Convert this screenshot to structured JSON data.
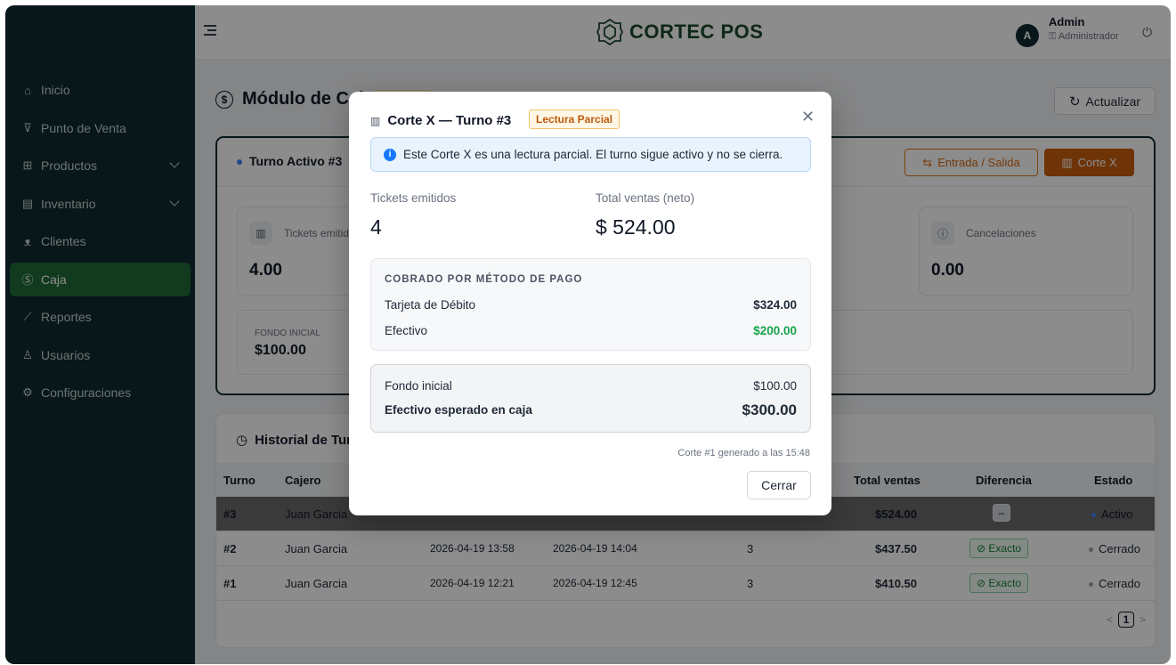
{
  "brand": {
    "name": "CORTEC POS"
  },
  "user": {
    "initial": "A",
    "name": "Admin",
    "role": "Administrador"
  },
  "sidebar": {
    "items": [
      {
        "label": "Inicio",
        "icon": "home-icon"
      },
      {
        "label": "Punto de Venta",
        "icon": "cart-icon"
      },
      {
        "label": "Productos",
        "icon": "grid-icon"
      },
      {
        "label": "Inventario",
        "icon": "inventory-icon"
      },
      {
        "label": "Clientes",
        "icon": "users-icon"
      },
      {
        "label": "Caja",
        "icon": "dollar-circle-icon"
      },
      {
        "label": "Reportes",
        "icon": "chart-icon"
      },
      {
        "label": "Usuarios",
        "icon": "user-icon"
      },
      {
        "label": "Configuraciones",
        "icon": "gear-icon"
      }
    ],
    "active": "Caja"
  },
  "page": {
    "title": "Módulo de Caja",
    "refresh_label": "Actualizar"
  },
  "shift": {
    "title": "Turno Activo #3",
    "entrada_label": "Entrada / Salida",
    "corte_label": "Corte X",
    "tickets_label": "Tickets emitidos",
    "tickets_value": "4.00",
    "cancel_label": "Cancelaciones",
    "cancel_value": "0.00",
    "fondo_label": "FONDO INICIAL",
    "fondo_value": "$100.00"
  },
  "history": {
    "title": "Historial de Turnos",
    "columns": {
      "turno": "Turno",
      "cajero": "Cajero",
      "total": "Total ventas",
      "diferencia": "Diferencia",
      "estado": "Estado"
    },
    "rows": [
      {
        "turno": "#3",
        "cajero": "Juan Garcia",
        "apertura": "",
        "cierre": "",
        "tickets": "",
        "total": "$524.00",
        "diferencia": "–",
        "estado": "Activo"
      },
      {
        "turno": "#2",
        "cajero": "Juan Garcia",
        "apertura": "2026-04-19 13:58",
        "cierre": "2026-04-19 14:04",
        "tickets": "3",
        "total": "$437.50",
        "diferencia": "Exacto",
        "estado": "Cerrado"
      },
      {
        "turno": "#1",
        "cajero": "Juan Garcia",
        "apertura": "2026-04-19 12:21",
        "cierre": "2026-04-19 12:45",
        "tickets": "3",
        "total": "$410.50",
        "diferencia": "Exacto",
        "estado": "Cerrado"
      }
    ],
    "page": "1"
  },
  "modal": {
    "title": "Corte X — Turno #3",
    "badge": "Lectura Parcial",
    "info": "Este Corte X es una lectura parcial. El turno sigue activo y no se cierra.",
    "tickets_label": "Tickets emitidos",
    "tickets_value": "4",
    "ventas_label": "Total ventas (neto)",
    "ventas_value": "$ 524.00",
    "pay_head": "COBRADO POR MÉTODO DE PAGO",
    "pay": [
      {
        "label": "Tarjeta de Débito",
        "amount": "$324.00",
        "color": "#1f2937"
      },
      {
        "label": "Efectivo",
        "amount": "$200.00",
        "color": "#16a34a"
      }
    ],
    "fondo_label": "Fondo inicial",
    "fondo_value": "$100.00",
    "esperado_label": "Efectivo esperado en caja",
    "esperado_value": "$300.00",
    "generated": "Corte #1 generado a las 15:48",
    "close_label": "Cerrar"
  },
  "colors": {
    "sidebar": "#0f2a2e",
    "active": "#1f6b3a",
    "accent": "#c85e0e",
    "success": "#16a34a",
    "info": "#1677ff"
  }
}
